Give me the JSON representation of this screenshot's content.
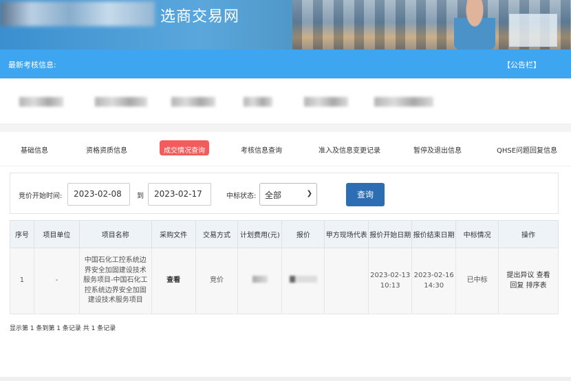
{
  "header": {
    "site_title": "选商交易网"
  },
  "notice_bar": {
    "label": "最新考核信息:",
    "board_link": "【公告栏】"
  },
  "tabs": [
    {
      "label": "基础信息",
      "active": false
    },
    {
      "label": "资格资质信息",
      "active": false
    },
    {
      "label": "成交情况查询",
      "active": true
    },
    {
      "label": "考核信息查询",
      "active": false
    },
    {
      "label": "准入及信息变更记录",
      "active": false
    },
    {
      "label": "暂停及退出信息",
      "active": false
    },
    {
      "label": "QHSE问题回复信息",
      "active": false
    }
  ],
  "filter": {
    "start_label": "竞价开始时间:",
    "start_date": "2023-02-08",
    "to_label": "到",
    "end_date": "2023-02-17",
    "status_label": "中标状态:",
    "status_value": "全部",
    "search_button": "查询"
  },
  "table": {
    "headers": [
      "序号",
      "项目单位",
      "项目名称",
      "采购文件",
      "交易方式",
      "计划费用(元)",
      "报价",
      "甲方现场代表",
      "报价开始日期",
      "报价结束日期",
      "中标情况",
      "操作"
    ],
    "rows": [
      {
        "index": "1",
        "unit": "-",
        "name": "中国石化工控系统边界安全加固建设技术服务项目-中国石化工控系统边界安全加固建设技术服务项目",
        "file": "查看",
        "method": "竞价",
        "start_date": "2023-02-13",
        "start_time": "10:13",
        "end_date": "2023-02-16",
        "end_time": "14:30",
        "result": "已中标",
        "ops": "提出异议 查看回复 排序表"
      }
    ]
  },
  "pagination": {
    "info": "显示第 1 条到第 1 条记录 共 1 条记录"
  },
  "colors": {
    "notice_bar": "#3ea6f0",
    "active_tab": "#f25c5c",
    "search_button": "#2c6db4"
  }
}
